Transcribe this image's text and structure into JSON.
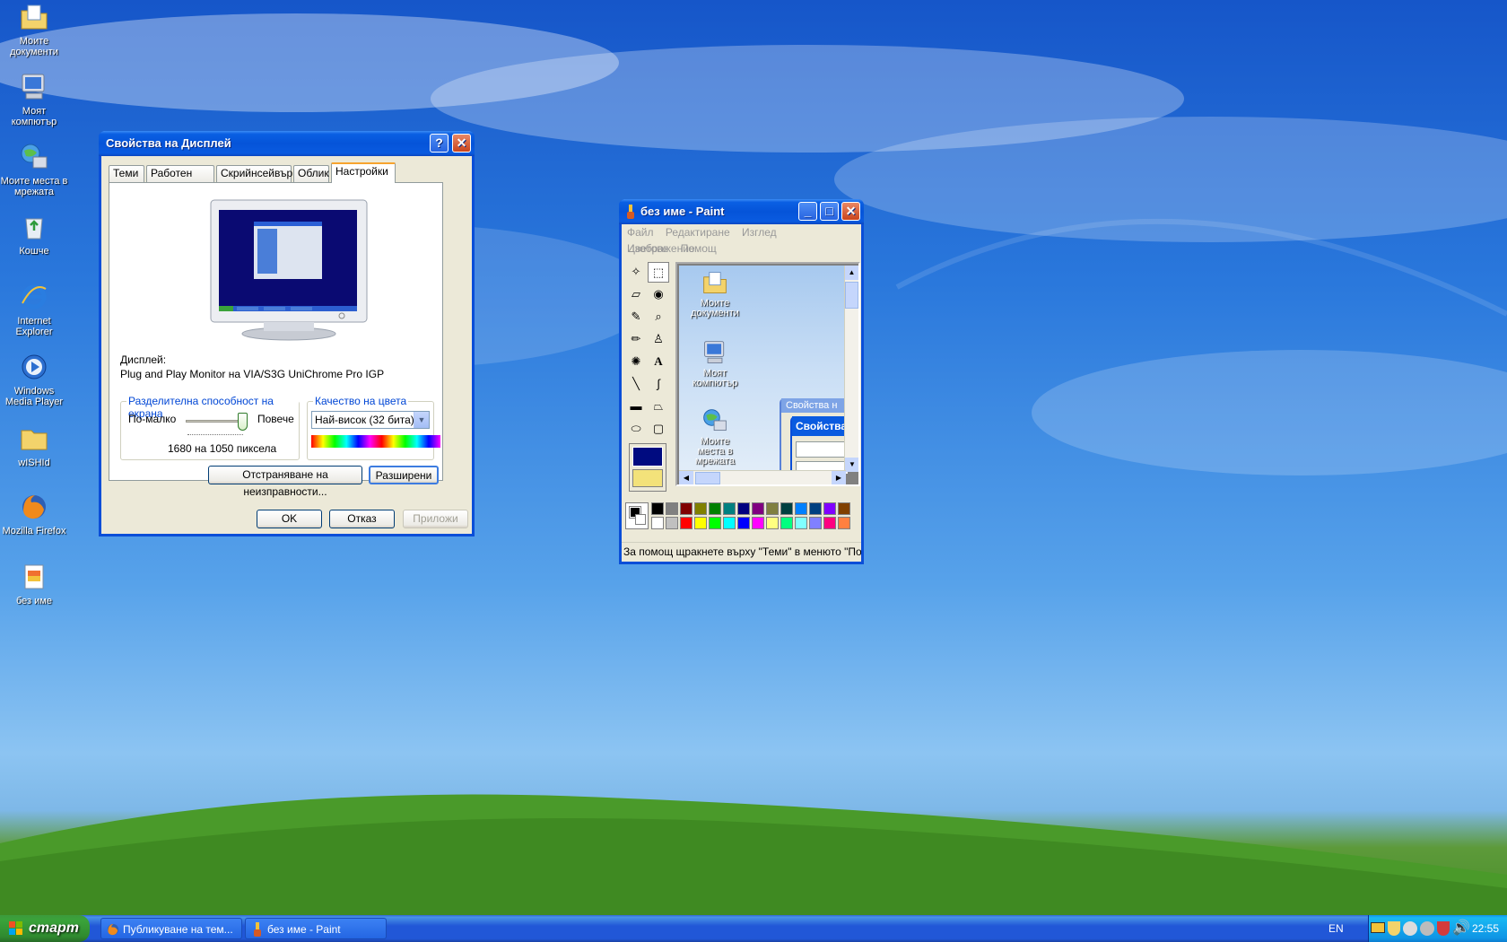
{
  "desktop": {
    "icons": [
      {
        "label": "Моите документи",
        "icon": "my-documents-icon"
      },
      {
        "label": "Моят компютър",
        "icon": "my-computer-icon"
      },
      {
        "label": "Моите места в мрежата",
        "icon": "network-places-icon"
      },
      {
        "label": "Кошче",
        "icon": "recycle-bin-icon"
      },
      {
        "label": "Internet Explorer",
        "icon": "internet-explorer-icon"
      },
      {
        "label": "Windows Media Player",
        "icon": "media-player-icon"
      },
      {
        "label": "wISHId",
        "icon": "folder-icon"
      },
      {
        "label": "Mozilla Firefox",
        "icon": "firefox-icon"
      },
      {
        "label": "без име",
        "icon": "paint-file-icon"
      }
    ]
  },
  "display_dialog": {
    "title": "Свойства на Дисплей",
    "help_button": "?",
    "close_button": "✕",
    "tabs": [
      "Теми",
      "Работен плот",
      "Скрийнсейвър",
      "Облик",
      "Настройки"
    ],
    "active_tab": "Настройки",
    "display_label": "Дисплей:",
    "display_value": "Plug and Play Monitor на VIA/S3G UniChrome Pro IGP",
    "resolution": {
      "legend": "Разделителна способност на екрана",
      "less": "По-малко",
      "more": "Повече",
      "value": "1680 на 1050 пиксела",
      "slider_level": 1.0
    },
    "color_quality": {
      "legend": "Качество на цвета",
      "selected": "Най-висок (32 бита)"
    },
    "troubleshoot_button": "Отстраняване на неизправности...",
    "advanced_button": "Разширени",
    "ok_button": "OK",
    "cancel_button": "Отказ",
    "apply_button": "Приложи"
  },
  "paint": {
    "title": "без име - Paint",
    "menu": [
      "Файл",
      "Редактиране",
      "Изглед",
      "Изображение",
      "Цветове",
      "Помощ"
    ],
    "canvas_icons": [
      "Моите документи",
      "Моят компютър",
      "Моите места в мрежата"
    ],
    "canvas_window_title": "Свойства н",
    "canvas_window_title2": "Свойства",
    "status": "За помощ щракнете върху \"Теми\" в менюто \"Пом",
    "colors": [
      "#000000",
      "#808080",
      "#800000",
      "#808000",
      "#008000",
      "#008080",
      "#000080",
      "#800080",
      "#808040",
      "#004040",
      "#0080ff",
      "#004080",
      "#8000ff",
      "#804000",
      "#ffffff",
      "#c0c0c0",
      "#ff0000",
      "#ffff00",
      "#00ff00",
      "#00ffff",
      "#0000ff",
      "#ff00ff",
      "#ffff80",
      "#00ff80",
      "#80ffff",
      "#8080ff",
      "#ff0080",
      "#ff8040"
    ]
  },
  "taskbar": {
    "start_label": "старт",
    "tasks": [
      {
        "label": "Публикуване на тем...",
        "icon": "firefox-icon"
      },
      {
        "label": "без име - Paint",
        "icon": "paint-icon"
      }
    ],
    "language": "EN",
    "clock": "22:55"
  }
}
